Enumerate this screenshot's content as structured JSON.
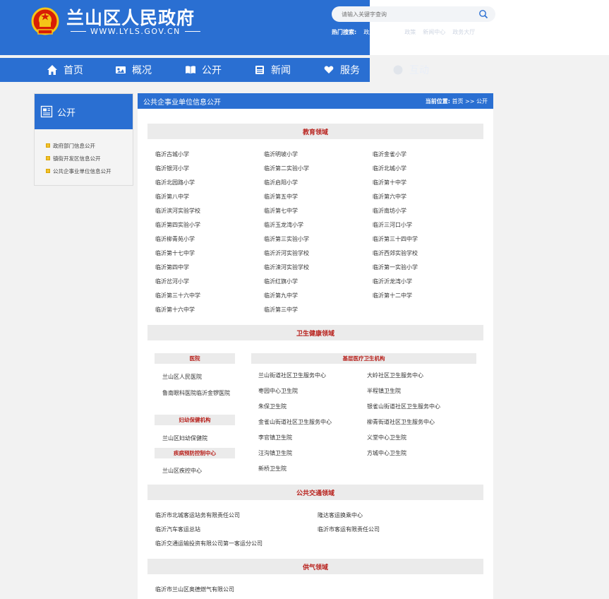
{
  "header": {
    "title": "兰山区人民政府",
    "url": "WWW.LYLS.GOV.CN",
    "search_placeholder": "请输入关键字查询",
    "hot_label": "热门搜索:",
    "hot_items": [
      "政府信息公开",
      "政策",
      "新闻中心",
      "政务大厅"
    ]
  },
  "nav": [
    {
      "label": "首页",
      "icon": "home-icon"
    },
    {
      "label": "概况",
      "icon": "overview-icon"
    },
    {
      "label": "公开",
      "icon": "book-icon"
    },
    {
      "label": "新闻",
      "icon": "news-icon"
    },
    {
      "label": "服务",
      "icon": "heart-hand-icon"
    },
    {
      "label": "互动",
      "icon": "chat-icon"
    }
  ],
  "sidebar": {
    "title": "公开",
    "items": [
      {
        "label": "政府部门信息公开"
      },
      {
        "label": "镇街开发区信息公开"
      },
      {
        "label": "公共企事业单位信息公开"
      }
    ]
  },
  "main": {
    "title": "公共企事业单位信息公开",
    "location_label": "当前位置:",
    "location_path": "首页 >> 公开"
  },
  "education": {
    "title": "教育领域",
    "items": [
      "临沂古城小学",
      "临沂明坡小学",
      "临沂金雀小学",
      "临沂银河小学",
      "临沂第二实验小学",
      "临沂北城小学",
      "临沂北园路小学",
      "临沂启阳小学",
      "临沂第十中学",
      "临沂第八中学",
      "临沂第五中学",
      "临沂第六中学",
      "临沂滨河实验学校",
      "临沂第七中学",
      "临沂南坊小学",
      "临沂第四实验小学",
      "临沂玉龙湾小学",
      "临沂三河口小学",
      "临沂柳青苑小学",
      "临沂第三实验小学",
      "临沂第三十四中学",
      "临沂第十七中学",
      "临沂沂河实验学校",
      "临沂西郊实验学校",
      "临沂第四中学",
      "临沂涑河实验学校",
      "临沂第一实验小学",
      "临沂岔河小学",
      "临沂红旗小学",
      "临沂沂龙湾小学",
      "临沂第三十六中学",
      "临沂第九中学",
      "临沂第十二中学",
      "临沂第十六中学",
      "临沂第三中学"
    ]
  },
  "health": {
    "title": "卫生健康领域",
    "hospital_title": "医院",
    "hospitals": [
      "兰山区人民医院",
      "鲁南眼科医院",
      "临沂金锣医院"
    ],
    "maternal_title": "妇幼保健机构",
    "maternal": [
      "兰山区妇幼保健院"
    ],
    "cdc_title": "疾病预防控制中心",
    "cdc": [
      "兰山区疾控中心"
    ],
    "primary_title": "基层医疗卫生机构",
    "primary": [
      "兰山街道社区卫生服务中心",
      "大岭社区卫生服务中心",
      "枣园中心卫生院",
      "半程镇卫生院",
      "朱保卫生院",
      "银雀山街道社区卫生服务中心",
      "金雀山街道社区卫生服务中心",
      "柳青街道社区卫生服务中心",
      "李官镇卫生院",
      "义堂中心卫生院",
      "汪沟镇卫生院",
      "方城中心卫生院",
      "新桥卫生院"
    ]
  },
  "transport": {
    "title": "公共交通领域",
    "items": [
      "临沂市北城客运站务有限责任公司",
      "隆达客运换乘中心",
      "临沂汽车客运总站",
      "临沂市客运有限责任公司",
      "临沂交通运输投资有限公司第一客运分公司"
    ]
  },
  "gas": {
    "title": "供气领域",
    "items": [
      "临沂市兰山区奥德燃气有限公司"
    ]
  },
  "colors": {
    "brand_blue": "#2a6fd2",
    "section_red": "#b8211c"
  }
}
